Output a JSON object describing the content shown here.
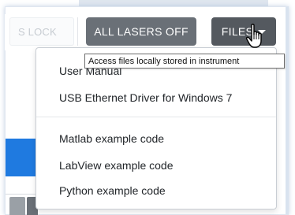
{
  "toolbar": {
    "faded_button_label": "S LOCK",
    "lasers_off_label": "ALL LASERS OFF",
    "files_label": "FILES"
  },
  "files_menu": {
    "items": [
      {
        "label": "User Manual"
      },
      {
        "label": "USB Ethernet Driver for Windows 7"
      },
      {
        "label": "Matlab example code"
      },
      {
        "label": "LabView example code"
      },
      {
        "label": "Python example code"
      }
    ]
  },
  "tooltip": {
    "text": "Access files locally stored in instrument"
  },
  "cursor": {
    "icon": "hand-pointer-icon"
  },
  "colors": {
    "button_dark": "#6a7077",
    "button_files": "#54595f",
    "accent_blue": "#1f7ae0"
  }
}
